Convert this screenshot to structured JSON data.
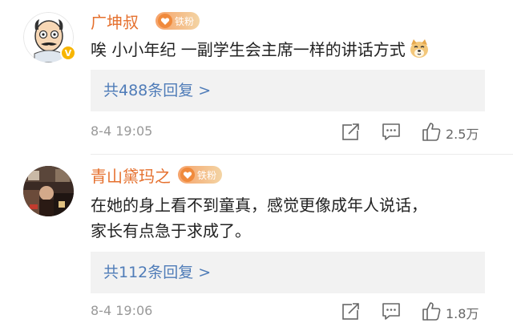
{
  "comments": [
    {
      "username": "广坤叔",
      "fan_badge": "铁粉",
      "verified_badge": "V",
      "text": "唉 小小年纪 一副学生会主席一样的讲话方式",
      "emoji": "doge-emoji",
      "replies": "共488条回复 >",
      "time": "8-4 19:05",
      "likes": "2.5万"
    },
    {
      "username": "青山黛玛之",
      "fan_badge": "铁粉",
      "text_line1": "在她的身上看不到童真，感觉更像成年人说话，",
      "text_line2": "家长有点急于求成了。",
      "replies": "共112条回复 >",
      "time": "8-4 19:06",
      "likes": "1.8万"
    }
  ],
  "colors": {
    "username": "#e5702e",
    "link": "#4f7cb8",
    "meta": "#999999",
    "reply_bg": "#f2f2f2"
  }
}
